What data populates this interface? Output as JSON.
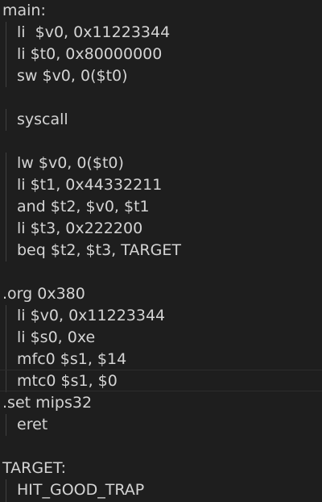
{
  "editor": {
    "colors": {
      "background": "#1e1e1e",
      "text": "#d4d4d4",
      "indent_guide": "#404040"
    },
    "lines": [
      {
        "text": "main:",
        "indent": 0
      },
      {
        "text": "li  $v0, 0x11223344",
        "indent": 1
      },
      {
        "text": "li $t0, 0x80000000",
        "indent": 1
      },
      {
        "text": "sw $v0, 0($t0)",
        "indent": 1
      },
      {
        "text": "",
        "indent": 0
      },
      {
        "text": "syscall",
        "indent": 1
      },
      {
        "text": "",
        "indent": 0
      },
      {
        "text": "lw $v0, 0($t0)",
        "indent": 1
      },
      {
        "text": "li $t1, 0x44332211",
        "indent": 1
      },
      {
        "text": "and $t2, $v0, $t1",
        "indent": 1
      },
      {
        "text": "li $t3, 0x222200",
        "indent": 1
      },
      {
        "text": "beq $t2, $t3, TARGET",
        "indent": 1
      },
      {
        "text": "",
        "indent": 0
      },
      {
        "text": ".org 0x380",
        "indent": 0
      },
      {
        "text": "li $v0, 0x11223344",
        "indent": 1
      },
      {
        "text": "li $s0, 0xe",
        "indent": 1
      },
      {
        "text": "mfc0 $s1, $14",
        "indent": 1
      },
      {
        "text": "mtc0 $s1, $0",
        "indent": 1
      },
      {
        "text": ".set mips32",
        "indent": 0
      },
      {
        "text": "eret",
        "indent": 1
      },
      {
        "text": "",
        "indent": 0
      },
      {
        "text": "TARGET:",
        "indent": 0
      },
      {
        "text": "HIT_GOOD_TRAP",
        "indent": 1
      }
    ]
  }
}
